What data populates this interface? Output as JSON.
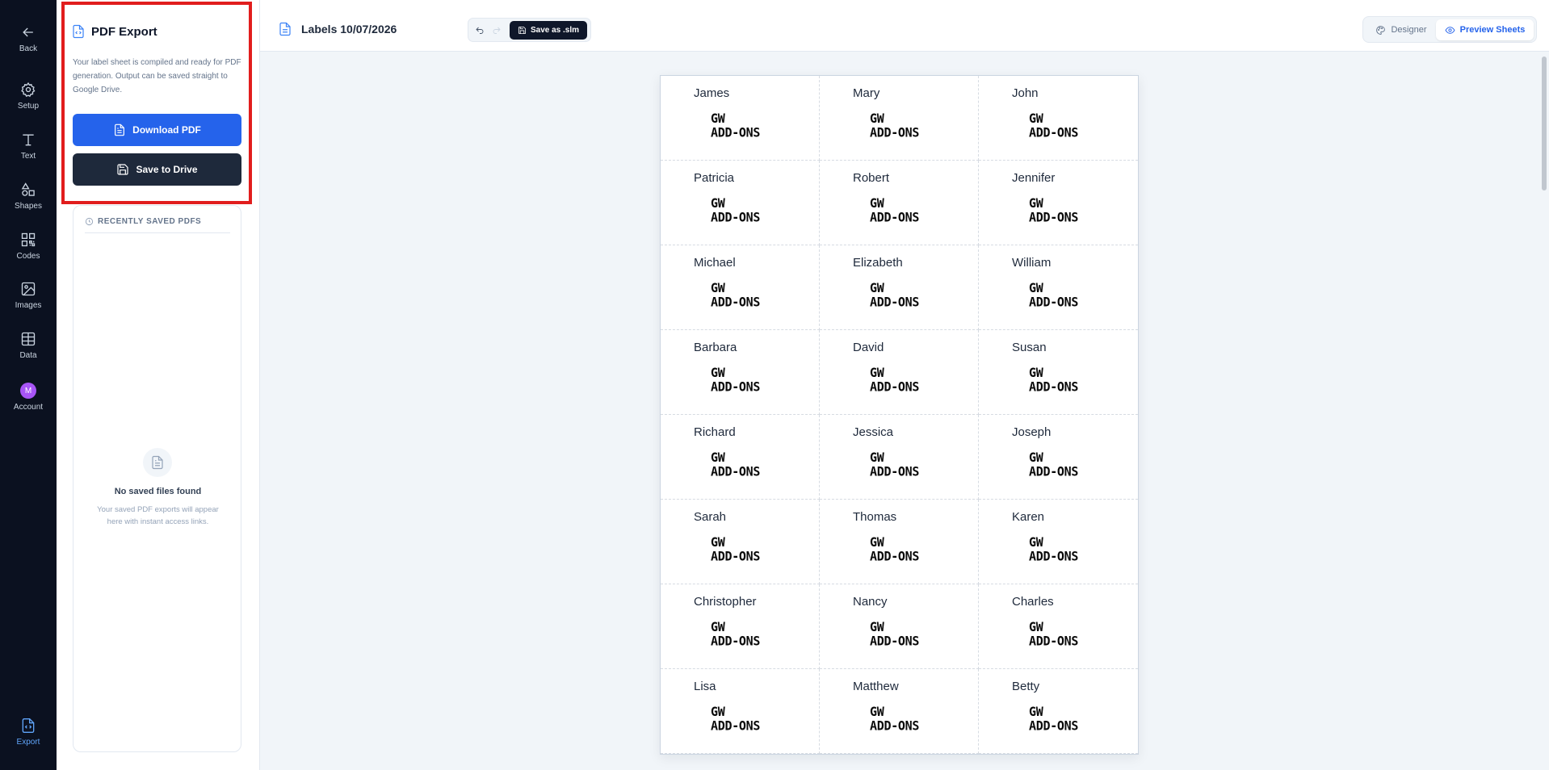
{
  "rail": {
    "items": [
      {
        "label": "Back",
        "icon": "arrow-left-icon"
      },
      {
        "label": "Setup",
        "icon": "gear-icon"
      },
      {
        "label": "Text",
        "icon": "text-icon"
      },
      {
        "label": "Shapes",
        "icon": "shapes-icon"
      },
      {
        "label": "Codes",
        "icon": "qr-code-icon"
      },
      {
        "label": "Images",
        "icon": "image-icon"
      },
      {
        "label": "Data",
        "icon": "table-icon"
      },
      {
        "label": "Account",
        "icon": "avatar",
        "avatar_letter": "M"
      },
      {
        "label": "Export",
        "icon": "file-code-icon"
      }
    ],
    "active": "Export",
    "active_color": "#60a5fa"
  },
  "export_panel": {
    "title": "PDF Export",
    "description": "Your label sheet is compiled and ready for PDF generation. Output can be saved straight to Google Drive.",
    "download_label": "Download PDF",
    "drive_label": "Save to Drive",
    "download_color": "#2563eb",
    "drive_color": "#1e293b",
    "highlight_color": "#e11d1d"
  },
  "recent": {
    "title": "RECENTLY SAVED PDFS",
    "empty_title": "No saved files found",
    "empty_desc": "Your saved PDF exports will appear here with instant access links."
  },
  "topbar": {
    "doc_title": "Labels 10/07/2026",
    "save_label": "Save as .slm",
    "designer_label": "Designer",
    "preview_label": "Preview Sheets",
    "active_view": "Preview Sheets"
  },
  "sheet": {
    "logo_line1": "GW",
    "logo_line2": "ADD-ONS",
    "labels": [
      "James",
      "Mary",
      "John",
      "Patricia",
      "Robert",
      "Jennifer",
      "Michael",
      "Elizabeth",
      "William",
      "Barbara",
      "David",
      "Susan",
      "Richard",
      "Jessica",
      "Joseph",
      "Sarah",
      "Thomas",
      "Karen",
      "Christopher",
      "Nancy",
      "Charles",
      "Lisa",
      "Matthew",
      "Betty"
    ]
  }
}
